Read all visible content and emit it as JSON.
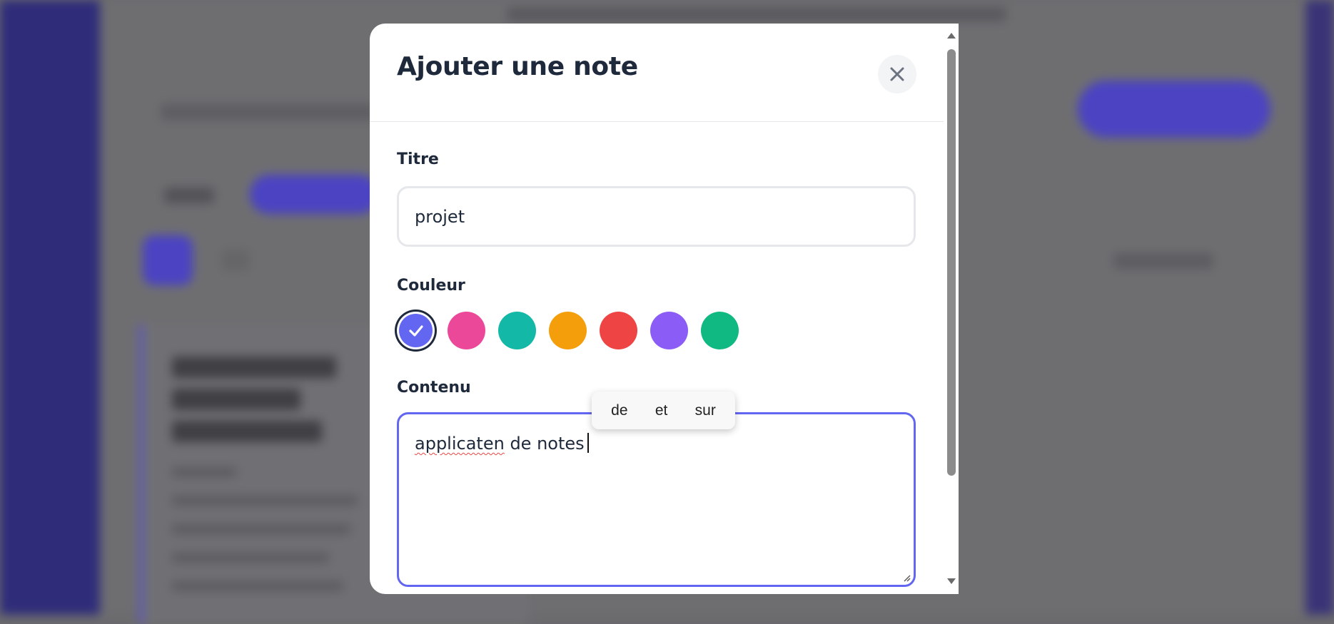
{
  "modal": {
    "title": "Ajouter une note",
    "close_icon": "close-icon",
    "title_field": {
      "label": "Titre",
      "value": "projet"
    },
    "color_field": {
      "label": "Couleur",
      "options": [
        {
          "color": "#6366f1",
          "selected": true
        },
        {
          "color": "#ec4899",
          "selected": false
        },
        {
          "color": "#14b8a6",
          "selected": false
        },
        {
          "color": "#f59e0b",
          "selected": false
        },
        {
          "color": "#ef4444",
          "selected": false
        },
        {
          "color": "#8b5cf6",
          "selected": false
        },
        {
          "color": "#10b981",
          "selected": false
        }
      ]
    },
    "content_field": {
      "label": "Contenu",
      "misspelled_word": "applicaten",
      "rest_text": " de notes"
    }
  },
  "autocomplete": {
    "suggestions": [
      "de",
      "et",
      "sur"
    ]
  },
  "colors": {
    "accent": "#6366f1",
    "title_text": "#1e293b",
    "border": "#e5e7eb"
  }
}
